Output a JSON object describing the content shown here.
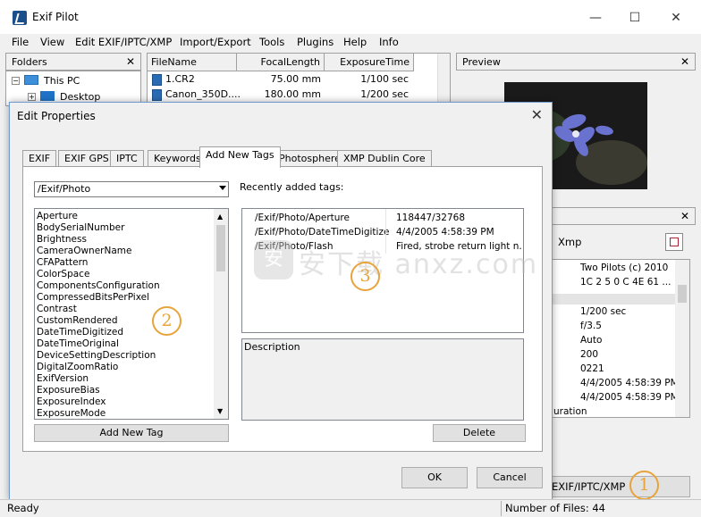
{
  "window": {
    "title": "Exif Pilot",
    "minimize_icon": "minimize-icon",
    "maximize_icon": "maximize-icon",
    "close_icon": "close-icon"
  },
  "menu": [
    "File",
    "View",
    "Edit EXIF/IPTC/XMP",
    "Import/Export",
    "Tools",
    "Plugins",
    "Help",
    "Info"
  ],
  "folders": {
    "title": "Folders",
    "items": [
      "This PC",
      "Desktop"
    ]
  },
  "files": {
    "columns": [
      "FileName",
      "FocalLength",
      "ExposureTime"
    ],
    "rows": [
      [
        "1.CR2",
        "75.00 mm",
        "1/100 sec"
      ],
      [
        "Canon_350D....",
        "180.00 mm",
        "1/200 sec"
      ]
    ]
  },
  "preview": {
    "title": "Preview"
  },
  "right_panel": {
    "xmp_tab": "Xmp",
    "values": [
      "Two Pilots (c) 2010",
      "1C 2 5 0 C 4E 61 ...",
      "1/200 sec",
      "f/3.5",
      "Auto",
      "200",
      "0221",
      "4/4/2005 4:58:39 PM",
      "4/4/2005 4:58:39 PM"
    ],
    "partial_label": "uration",
    "edit_button": "EXIF/IPTC/XMP"
  },
  "dialog": {
    "title": "Edit Properties",
    "tabs": [
      "EXIF",
      "EXIF GPS",
      "IPTC",
      "Keywords",
      "Add New Tags",
      "Photosphere",
      "XMP Dublin Core"
    ],
    "active_tab": "Add New Tags",
    "path_select": "/Exif/Photo",
    "tag_list": [
      "Aperture",
      "BodySerialNumber",
      "Brightness",
      "CameraOwnerName",
      "CFAPattern",
      "ColorSpace",
      "ComponentsConfiguration",
      "CompressedBitsPerPixel",
      "Contrast",
      "CustomRendered",
      "DateTimeDigitized",
      "DateTimeOriginal",
      "DeviceSettingDescription",
      "DigitalZoomRatio",
      "ExifVersion",
      "ExposureBias",
      "ExposureIndex",
      "ExposureMode"
    ],
    "add_button": "Add New Tag",
    "recent_label": "Recently added tags:",
    "recent_tags": [
      [
        "/Exif/Photo/Aperture",
        "118447/32768"
      ],
      [
        "/Exif/Photo/DateTimeDigitized",
        "4/4/2005 4:58:39 PM"
      ],
      [
        "/Exif/Photo/Flash",
        "Fired, strobe return light n..."
      ]
    ],
    "description_label": "Description",
    "delete_button": "Delete",
    "ok_button": "OK",
    "cancel_button": "Cancel"
  },
  "badges": [
    "1",
    "2",
    "3"
  ],
  "watermark": "安下载 anxz.com",
  "status": {
    "left": "Ready",
    "right": "Number of Files: 44"
  },
  "colors": {
    "accent": "#e8a33a",
    "dialog_border": "#6f9bd1",
    "selection": "#0078d7"
  }
}
